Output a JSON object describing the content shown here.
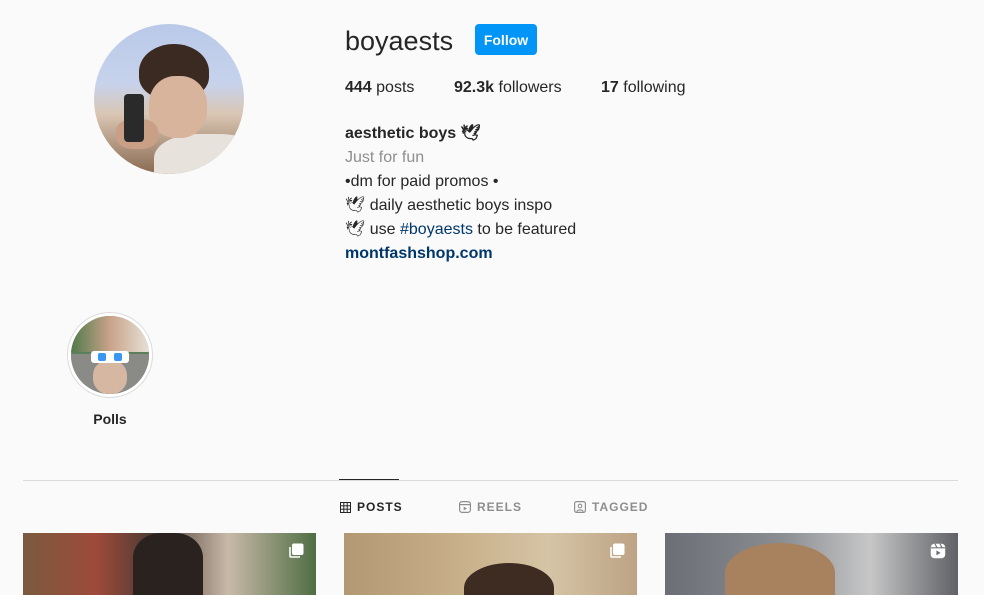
{
  "profile": {
    "username": "boyaests",
    "follow_label": "Follow",
    "stats": {
      "posts_count": "444",
      "posts_label": "posts",
      "followers_count": "92.3k",
      "followers_label": "followers",
      "following_count": "17",
      "following_label": "following"
    },
    "bio": {
      "name": "aesthetic boys 🕊",
      "category": "Just for fun",
      "line1": "•dm for paid promos •",
      "line2": "🕊 daily aesthetic boys inspo",
      "line3_prefix": "🕊 use ",
      "line3_hashtag": "#boyaests",
      "line3_suffix": " to be featured",
      "website": "montfashshop.com"
    }
  },
  "highlights": [
    {
      "label": "Polls"
    }
  ],
  "tabs": {
    "posts": "POSTS",
    "reels": "REELS",
    "tagged": "TAGGED",
    "active": "posts"
  },
  "posts": [
    {
      "type": "carousel",
      "badge_icon": "carousel-icon"
    },
    {
      "type": "carousel",
      "badge_icon": "carousel-icon"
    },
    {
      "type": "reel",
      "badge_icon": "reel-icon"
    }
  ],
  "colors": {
    "follow_button": "#0095f6",
    "link": "#00376b",
    "muted": "#8e8e8e"
  }
}
